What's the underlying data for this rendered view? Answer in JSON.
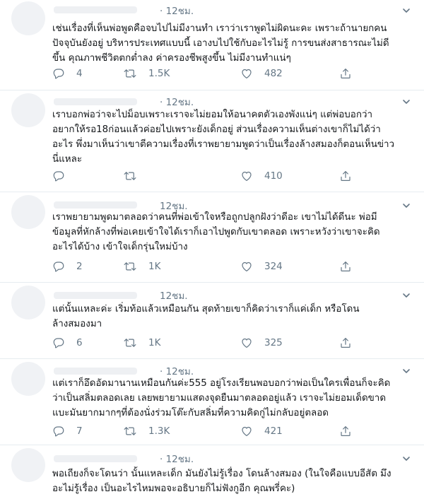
{
  "tweets": [
    {
      "time": "· 12ชม.",
      "lines": [
        "เช่นเรื่องที่เห็นพ่อพูดคือจบไปไม่มีงานทำ เราว่าเราพูดไม่ผิดนะคะ เพราะถ้านายกคน",
        "ปัจจุบันยังอยู่ บริหารประเทศแบบนี้ เอางบไปใช้กับอะไรไม่รู้ การขนส่งสาธารณะไม่ดี",
        "ขึ้น คุณภาพชีวิตตกต่ำลง ค่าครองชีพสูงขึ้น ไม่มีงานทำแน่ๆ"
      ],
      "replies": "4",
      "retweets": "1.5K",
      "likes": "482"
    },
    {
      "time": "· 12ชม.",
      "lines": [
        "เราบอกพ่อว่าจะไปม็อบเพราะเราจะไม่ยอมให้อนาคตตัวเองพังแน่ๆ แต่พ่อบอกว่า",
        "อยากให้รอ18ก่อนแล้วค่อยไปเพราะยังเด็กอยู่ ส่วนเรื่องความเห็นต่างเขาก็ไม่ได้ว่า",
        "อะไร พึ่งมาเห็นว่าเขาตีความเรื่องที่เราพยายามพูดว่าเป็นเรื่องล้างสมองก็ตอนเห็นข่าว",
        "นี่แหละ"
      ],
      "replies": "",
      "retweets": "",
      "likes": "410"
    },
    {
      "time": "12ชม.",
      "lines": [
        "เราพยายามพูดมาตลอดว่าคนที่พ่อเข้าใจหรือถูกปลูกฝังว่าดีอะ เขาไม่ได้ดีนะ พ่อมี",
        "ข้อมูลที่หักล้างที่พ่อเคยเข้าใจได้เราก็เอาไปพูดกับเขาตลอด เพราะหวังว่าเขาจะคิด",
        "อะไรได้บ้าง เข้าใจเด็กรุ่นใหม่บ้าง"
      ],
      "replies": "2",
      "retweets": "1K",
      "likes": "324"
    },
    {
      "time": "12ชม.",
      "lines": [
        "แต่นั้นแหละค่ะ เริ่มท้อแล้วเหมือนกัน สุดท้ายเขาก็คิดว่าเราก็แค่เด็ก หรือโดน",
        "ล้างสมองมา"
      ],
      "replies": "6",
      "retweets": "1K",
      "likes": "325"
    },
    {
      "time": "· 12ชม.",
      "lines": [
        "แต่เราก็อึดอัดมานานเหมือนกันค่ะ555 อยู่โรงเรียนพอบอกว่าพ่อเป็นใครเพื่อนก็จะคิด",
        "ว่าเป็นสลิ่มตลอดเลย เลยพยายามแสดงจุดยืนมาตลอดอยู่แล้ว เราจะไม่ยอมเด็ดขาด",
        "แบะมันยากมากๆที่ต้องนั่งร่วมโต๊ะกับสลิ่มที่ความคิดกู่ไม่กลับอยู่ตลอด"
      ],
      "replies": "7",
      "retweets": "1.3K",
      "likes": "421"
    },
    {
      "time": "· 12ชม.",
      "lines": [
        "พอเถียงก็จะโดนว่า นั้นแหละเด็ก มันยังไม่รู้เรื่อง โดนล้างสมอง (ในใจคือแบบอีสัต มึง",
        "อะไม่รู้เรื่อง เป็นอะไรไหมพอจะอธิบายก็ไม่ฟังกูอีก คุณพรี่คะ)"
      ],
      "replies": "",
      "retweets": "",
      "likes": ""
    }
  ],
  "icons": {
    "reply": "reply-icon",
    "retweet": "retweet-icon",
    "like": "heart-icon",
    "share": "share-icon",
    "more": "chevron-down-icon"
  },
  "colors": {
    "text": "#14171a",
    "muted": "#657786",
    "divider": "#e6ecf0"
  }
}
